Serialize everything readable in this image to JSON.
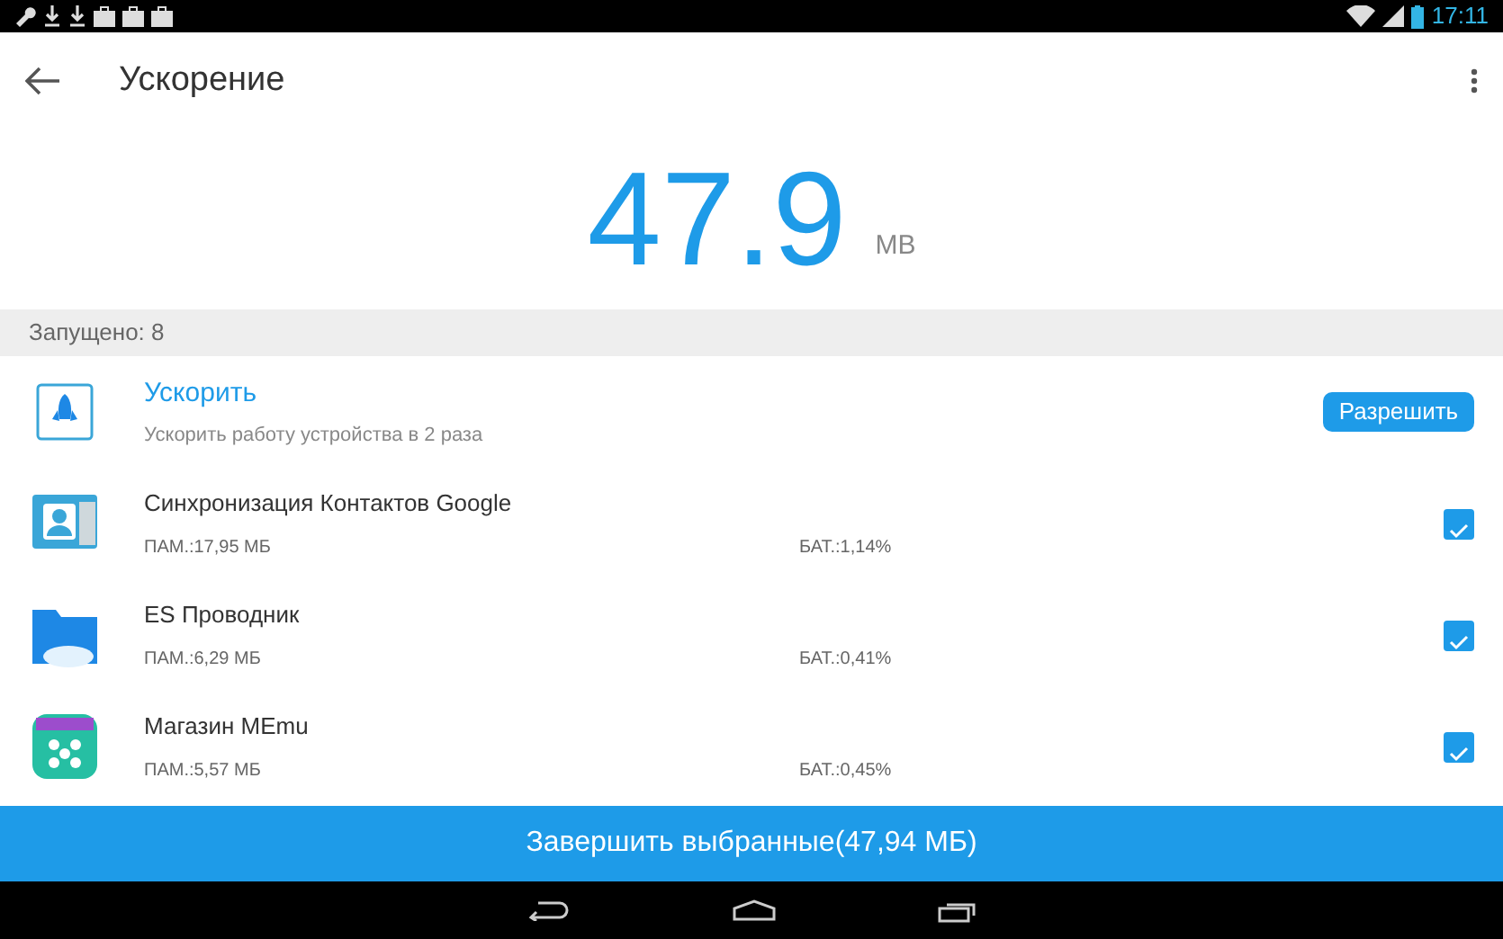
{
  "status_bar": {
    "time": "17:11"
  },
  "app_bar": {
    "title": "Ускорение"
  },
  "summary": {
    "value": "47.9",
    "unit": "MB"
  },
  "section": {
    "label": "Запущено: 8"
  },
  "boost": {
    "title": "Ускорить",
    "subtitle": "Ускорить работу устройства в 2 раза",
    "button": "Разрешить"
  },
  "apps": [
    {
      "name": "Синхронизация Контактов Google",
      "memory": "ПАМ.:17,95 МБ",
      "battery": "БАТ.:1,14%",
      "checked": true,
      "kind": "contacts"
    },
    {
      "name": "ES Проводник",
      "memory": "ПАМ.:6,29 МБ",
      "battery": "БАТ.:0,41%",
      "checked": true,
      "kind": "folder"
    },
    {
      "name": "Магазин MEmu",
      "memory": "ПАМ.:5,57 МБ",
      "battery": "БАТ.:0,45%",
      "checked": true,
      "kind": "store"
    }
  ],
  "action_button": "Завершить выбранные(47,94 МБ)"
}
